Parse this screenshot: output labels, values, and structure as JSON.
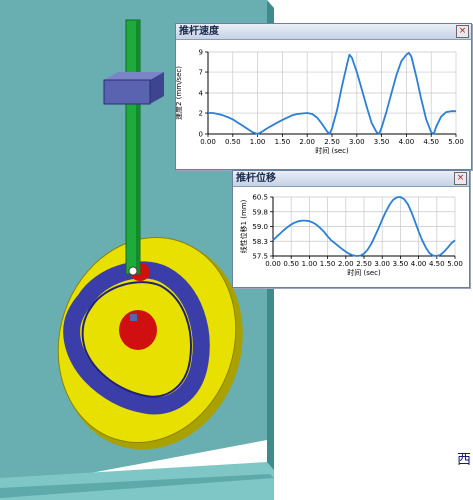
{
  "charts_windows": {
    "speed": {
      "title": "推杆速度",
      "close": "×"
    },
    "disp": {
      "title": "推杆位移",
      "close": "×"
    }
  },
  "corner_text": "西",
  "colors": {
    "wall": "#69aeb0",
    "floor": "#7fc6c6",
    "rod": "#1faa3c",
    "slider_block": "#5a63b0",
    "cam_disc": "#e8e000",
    "cam_groove": "#3b3ea8",
    "cam_hub": "#d01010",
    "curve": "#2b7fd6",
    "axis": "#000000",
    "grid": "#c8c8c8"
  },
  "chart_data": [
    {
      "type": "line",
      "title": "推杆速度",
      "xlabel": "时间 (sec)",
      "ylabel": "速度2 (mm/sec)",
      "xlim": [
        0,
        5
      ],
      "ylim": [
        0,
        9
      ],
      "xticks": [
        "0.00",
        "0.50",
        "1.00",
        "1.50",
        "2.00",
        "2.50",
        "3.00",
        "3.50",
        "4.00",
        "4.50",
        "5.00"
      ],
      "yticks": [
        "0",
        "2",
        "4",
        "7",
        "9"
      ],
      "ytick_values": [
        0,
        2.3,
        4.5,
        6.8,
        9
      ],
      "grid": true,
      "series": [
        {
          "x": [
            0.0,
            0.1,
            0.2,
            0.3,
            0.4,
            0.5,
            0.6,
            0.7,
            0.8,
            0.9,
            1.0,
            1.1,
            1.2,
            1.3,
            1.4,
            1.5,
            1.6,
            1.7,
            1.8,
            1.9,
            2.0,
            2.1,
            2.2,
            2.3,
            2.4,
            2.45,
            2.5,
            2.6,
            2.7,
            2.8,
            2.85,
            2.9,
            3.0,
            3.1,
            3.2,
            3.3,
            3.4,
            3.45,
            3.5,
            3.6,
            3.7,
            3.8,
            3.9,
            4.0,
            4.05,
            4.1,
            4.2,
            4.3,
            4.4,
            4.5,
            4.55,
            4.6,
            4.7,
            4.8,
            4.9,
            5.0
          ],
          "y": [
            2.3,
            2.3,
            2.2,
            2.05,
            1.85,
            1.6,
            1.25,
            0.9,
            0.55,
            0.2,
            0.0,
            0.3,
            0.65,
            0.95,
            1.25,
            1.55,
            1.8,
            2.05,
            2.2,
            2.25,
            2.3,
            2.2,
            1.8,
            1.1,
            0.3,
            0.0,
            0.6,
            2.6,
            5.2,
            7.6,
            8.7,
            8.4,
            6.8,
            4.9,
            3.0,
            1.2,
            0.2,
            0.0,
            0.7,
            2.5,
            4.5,
            6.5,
            8.0,
            8.7,
            8.9,
            8.5,
            6.3,
            3.8,
            1.6,
            0.2,
            0.0,
            0.8,
            1.9,
            2.4,
            2.5,
            2.5
          ]
        }
      ]
    },
    {
      "type": "line",
      "title": "推杆位移",
      "xlabel": "时间 (sec)",
      "ylabel": "线性位移1 (mm)",
      "xlim": [
        0,
        5
      ],
      "ylim": [
        57.5,
        60.5
      ],
      "xticks": [
        "0.00",
        "0.50",
        "1.00",
        "1.50",
        "2.00",
        "2.50",
        "3.00",
        "3.50",
        "4.00",
        "4.50",
        "5.00"
      ],
      "yticks": [
        "60.5",
        "59.8",
        "59.0",
        "58.3",
        "57.5"
      ],
      "ytick_values": [
        60.5,
        59.75,
        59.0,
        58.25,
        57.5
      ],
      "grid": true,
      "series": [
        {
          "x": [
            0.0,
            0.1,
            0.2,
            0.3,
            0.4,
            0.5,
            0.6,
            0.7,
            0.8,
            0.9,
            1.0,
            1.1,
            1.2,
            1.3,
            1.4,
            1.5,
            1.6,
            1.7,
            1.8,
            1.9,
            2.0,
            2.1,
            2.2,
            2.3,
            2.4,
            2.5,
            2.6,
            2.7,
            2.8,
            2.9,
            3.0,
            3.1,
            3.2,
            3.3,
            3.4,
            3.5,
            3.6,
            3.7,
            3.8,
            3.9,
            4.0,
            4.1,
            4.2,
            4.3,
            4.4,
            4.5,
            4.6,
            4.7,
            4.8,
            4.9,
            5.0
          ],
          "y": [
            58.3,
            58.48,
            58.65,
            58.82,
            58.97,
            59.1,
            59.2,
            59.27,
            59.3,
            59.3,
            59.27,
            59.2,
            59.08,
            58.92,
            58.73,
            58.5,
            58.3,
            58.15,
            58.0,
            57.85,
            57.72,
            57.6,
            57.53,
            57.5,
            57.52,
            57.62,
            57.82,
            58.12,
            58.5,
            58.92,
            59.35,
            59.75,
            60.1,
            60.35,
            60.48,
            60.5,
            60.4,
            60.15,
            59.75,
            59.25,
            58.75,
            58.3,
            57.92,
            57.65,
            57.52,
            57.5,
            57.56,
            57.72,
            57.92,
            58.15,
            58.3
          ]
        }
      ]
    }
  ]
}
